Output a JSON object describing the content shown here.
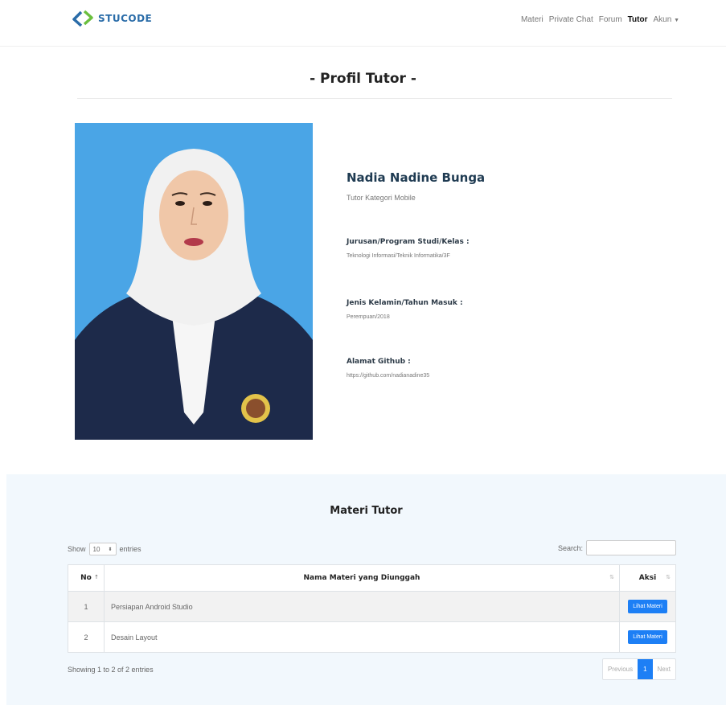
{
  "navbar": {
    "brand": "STUCODE",
    "links": [
      "Materi",
      "Private Chat",
      "Forum",
      "Tutor",
      "Akun"
    ]
  },
  "page": {
    "title": "- Profil Tutor -"
  },
  "profile": {
    "name": "Nadia Nadine Bunga",
    "category": "Tutor Kategori Mobile",
    "jurusan_label": "Jurusan/Program Studi/Kelas :",
    "jurusan_value": "Teknologi Informasi/Teknik Informatika/3F",
    "gender_label": "Jenis Kelamin/Tahun Masuk :",
    "gender_value": "Perempuan/2018",
    "github_label": "Alamat Github :",
    "github_value": "https://github.com/nadianadine35"
  },
  "materi": {
    "title": "Materi Tutor",
    "show_label": "Show",
    "entries_value": "10",
    "entries_label": "entries",
    "search_label": "Search:",
    "columns": [
      "No",
      "Nama Materi yang Diunggah",
      "Aksi"
    ],
    "rows": [
      {
        "no": "1",
        "name": "Persiapan Android Studio",
        "action": "Lihat Materi"
      },
      {
        "no": "2",
        "name": "Desain Layout",
        "action": "Lihat Materi"
      }
    ],
    "showing": "Showing 1 to 2 of 2 entries",
    "pagination": {
      "previous": "Previous",
      "current": "1",
      "next": "Next"
    }
  },
  "colors": {
    "brand": "#2a6ca8",
    "accent": "#1d7ff5",
    "section_bg": "#f2f8fd",
    "photo_bg": "#4aa5e6"
  }
}
